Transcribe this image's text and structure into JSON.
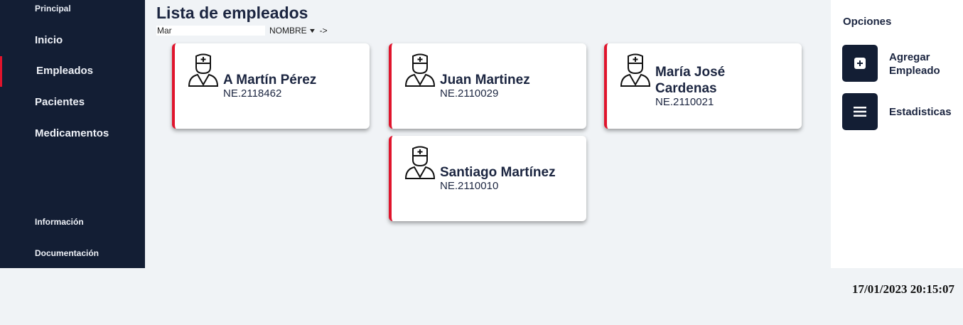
{
  "sidebar": {
    "section_main": "Principal",
    "items": [
      {
        "label": "Inicio"
      },
      {
        "label": "Empleados"
      },
      {
        "label": "Pacientes"
      },
      {
        "label": "Medicamentos"
      }
    ],
    "section_info": "Información",
    "docs_label": "Documentación",
    "active": "Empleados"
  },
  "main": {
    "title": "Lista de empleados",
    "search": {
      "value": "Mar",
      "placeholder": ""
    },
    "sort": {
      "selected": "NOMBRE"
    },
    "go_label": "->",
    "employees": [
      {
        "name": "A Martín Pérez",
        "code": "NE.2118462"
      },
      {
        "name": "Juan Martinez",
        "code": "NE.2110029"
      },
      {
        "name": "María José Cardenas",
        "code": "NE.2110021"
      },
      {
        "name": "Santiago Martínez",
        "code": "NE.2110010"
      }
    ],
    "avatar_icon": "doctor-icon"
  },
  "options": {
    "title": "Opciones",
    "add_label": "Agregar Empleado",
    "add_icon": "plus-icon",
    "stats_label": "Estadisticas",
    "stats_icon": "menu-icon"
  },
  "datetime": "17/01/2023 20:15:07",
  "colors": {
    "sidebar": "#131e34",
    "accent": "#e0142c",
    "background": "#f0f3f6"
  }
}
